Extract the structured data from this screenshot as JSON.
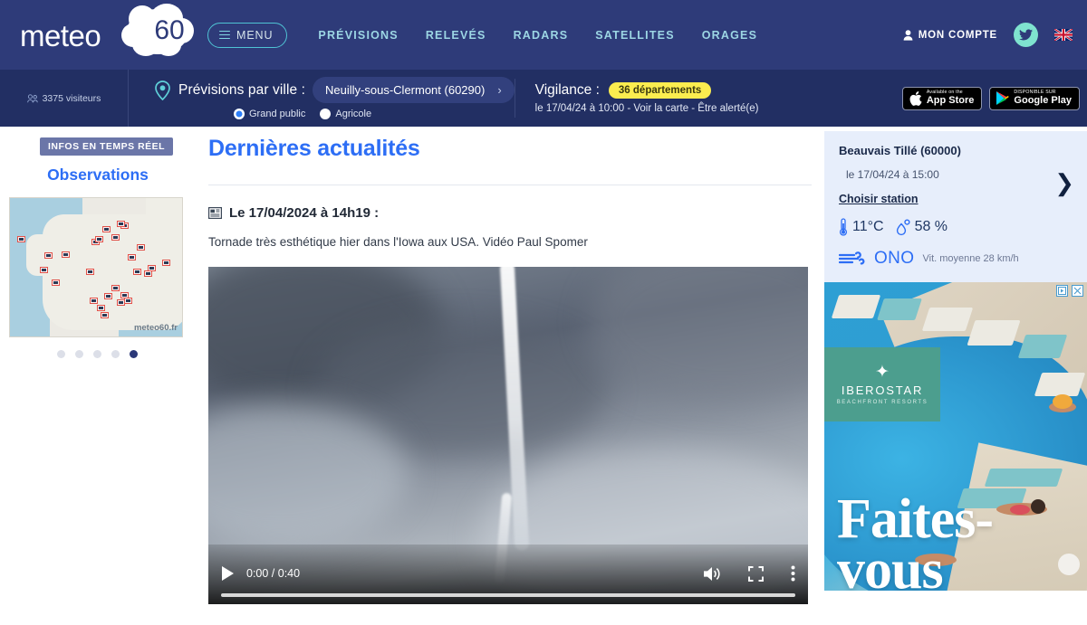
{
  "header": {
    "logo": {
      "word": "meteo",
      "number": "60"
    },
    "menu_button": "MENU",
    "nav": [
      {
        "label": "PRÉVISIONS"
      },
      {
        "label": "RELEVÉS"
      },
      {
        "label": "RADARS"
      },
      {
        "label": "SATELLITES"
      },
      {
        "label": "ORAGES"
      }
    ],
    "account_label": "MON COMPTE",
    "twitter_icon": "twitter-icon",
    "flag_icon": "uk-flag-icon"
  },
  "subheader": {
    "visitors": "3375 visiteurs",
    "city_label": "Prévisions par ville :",
    "city_value": "Neuilly-sous-Clermont (60290)",
    "chevron": "›",
    "radios": [
      {
        "label": "Grand public",
        "selected": true
      },
      {
        "label": "Agricole",
        "selected": false
      }
    ],
    "vigilance_label": "Vigilance :",
    "vigilance_badge": "36 départements",
    "vigilance_sub": "le 17/04/24 à 10:00 - Voir la carte - Être alerté(e)",
    "appstore": {
      "small": "Available on the",
      "big": "App Store"
    },
    "googleplay": {
      "small": "DISPONIBLE SUR",
      "big": "Google Play"
    }
  },
  "sidebar": {
    "badge": "INFOS EN TEMPS RÉEL",
    "title": "Observations",
    "map_watermark": "meteo60.fr",
    "dots_count": 5,
    "active_dot": 5
  },
  "main": {
    "heading": "Dernières actualités",
    "article": {
      "date": "Le 17/04/2024 à 14h19 :",
      "body": "Tornade très esthétique hier dans l'Iowa aux USA. Vidéo Paul Spomer",
      "video": {
        "current_time": "0:00",
        "duration": "0:40",
        "time_display": "0:00 / 0:40",
        "play_icon": "play-icon",
        "volume_icon": "volume-icon",
        "fullscreen_icon": "fullscreen-icon",
        "more_icon": "more-options-icon"
      }
    }
  },
  "weather": {
    "station": "Beauvais Tillé (60000)",
    "datetime": "le 17/04/24 à 15:00",
    "choose_station": "Choisir station",
    "temperature": "11°C",
    "humidity": "58 %",
    "wind_direction": "ONO",
    "wind_speed": "Vit. moyenne 28 km/h",
    "arrow": "❯"
  },
  "ad": {
    "brand": "IBEROSTAR",
    "brand_sub": "BEACHFRONT RESORTS",
    "headline_line1": "Faites-",
    "headline_line2": "vous",
    "star_glyph": "✦",
    "adchoices_icon": "adchoices-icon",
    "close_icon": "close-icon"
  },
  "colors": {
    "header_bg": "#2e3b79",
    "subheader_bg": "#222f63",
    "accent_blue": "#2d6ef5",
    "cyan": "#4fc3d4",
    "nav_text": "#9cd6e4",
    "vigilance_yellow": "#fbed4f",
    "weather_card_bg": "#e7eefb",
    "brand_green": "#4c9e8e"
  }
}
